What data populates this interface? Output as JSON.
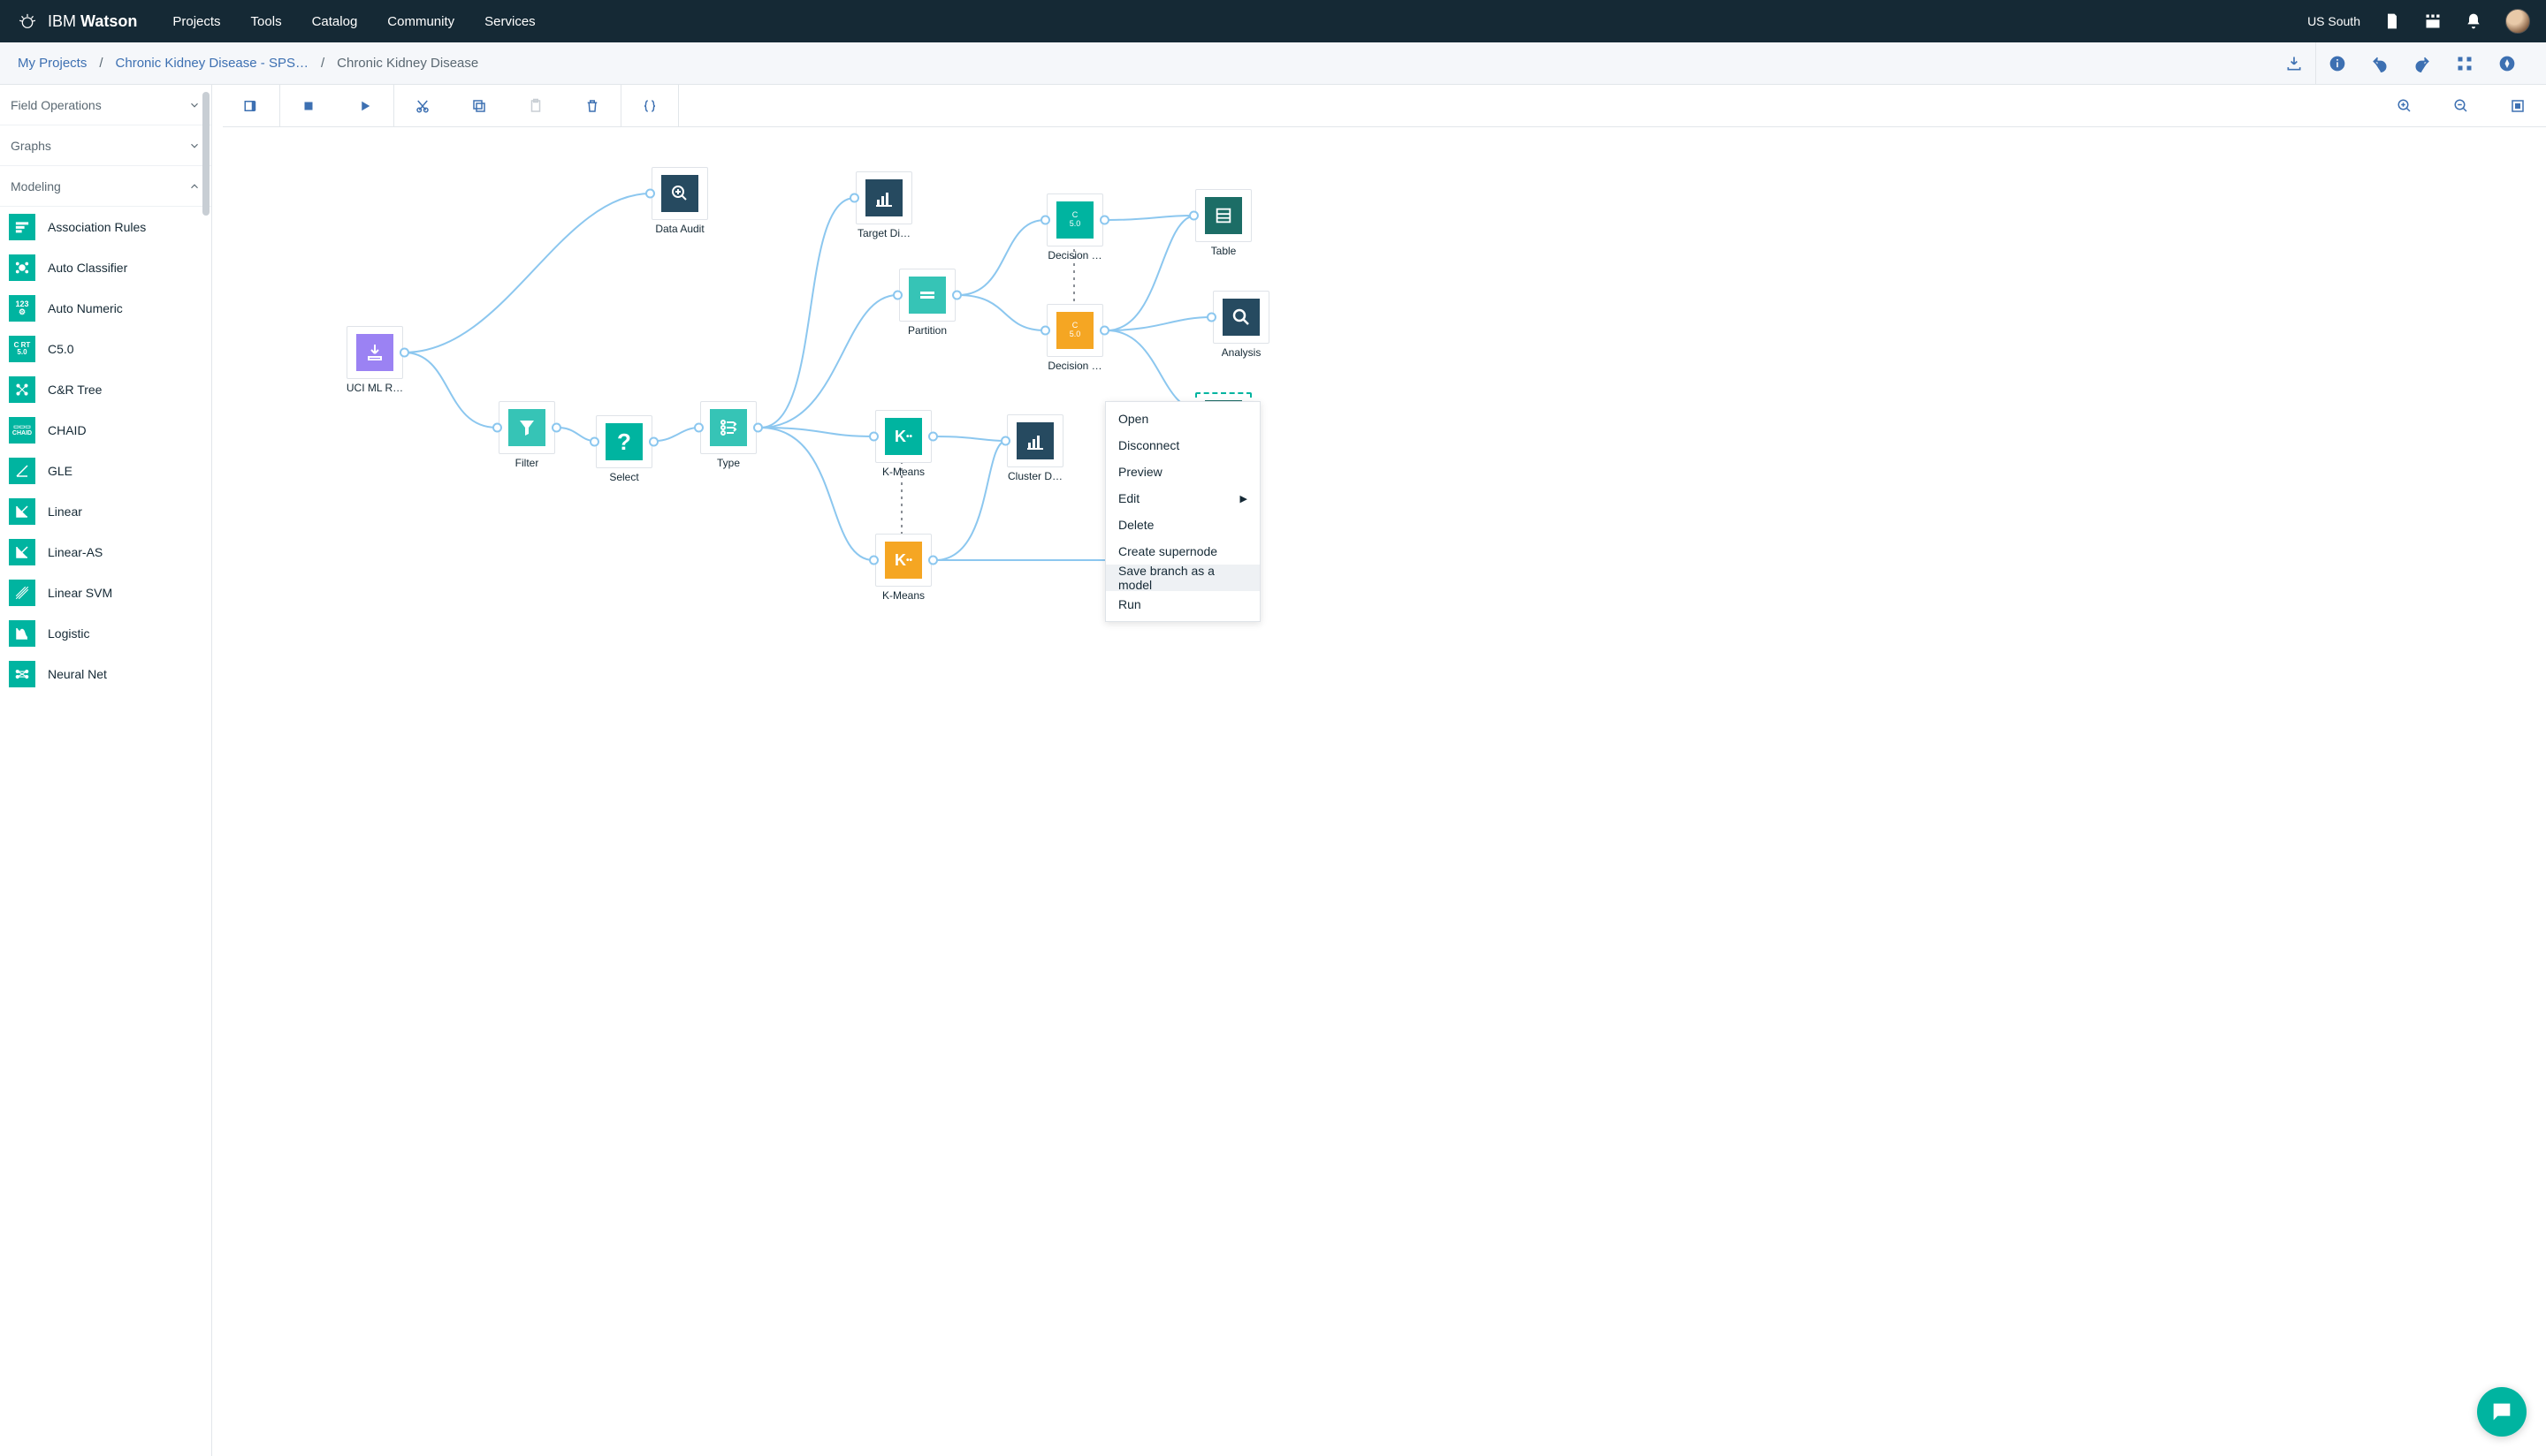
{
  "header": {
    "brand_prefix": "IBM",
    "brand_name": "Watson",
    "nav": [
      "Projects",
      "Tools",
      "Catalog",
      "Community",
      "Services"
    ],
    "region": "US South"
  },
  "breadcrumb": {
    "items": [
      "My Projects",
      "Chronic Kidney Disease - SPS…",
      "Chronic Kidney Disease"
    ]
  },
  "sidebar": {
    "groups": [
      {
        "label": "Field Operations",
        "expanded": false
      },
      {
        "label": "Graphs",
        "expanded": false
      },
      {
        "label": "Modeling",
        "expanded": true
      }
    ],
    "modeling_items": [
      "Association Rules",
      "Auto Classifier",
      "Auto Numeric",
      "C5.0",
      "C&R Tree",
      "CHAID",
      "GLE",
      "Linear",
      "Linear-AS",
      "Linear SVM",
      "Logistic",
      "Neural Net"
    ]
  },
  "canvas": {
    "nodes": {
      "uci": {
        "label": "UCI ML R…"
      },
      "audit": {
        "label": "Data Audit"
      },
      "filter": {
        "label": "Filter"
      },
      "select": {
        "label": "Select"
      },
      "type": {
        "label": "Type"
      },
      "target": {
        "label": "Target Di…"
      },
      "partition": {
        "label": "Partition"
      },
      "kmeans1": {
        "label": "K-Means"
      },
      "kmeans2": {
        "label": "K-Means"
      },
      "cluster": {
        "label": "Cluster D…"
      },
      "dec1": {
        "label": "Decision …"
      },
      "dec2": {
        "label": "Decision …"
      },
      "table": {
        "label": "Table"
      },
      "analysis": {
        "label": "Analysis"
      }
    }
  },
  "context_menu": {
    "items": [
      "Open",
      "Disconnect",
      "Preview",
      "Edit",
      "Delete",
      "Create supernode",
      "Save branch as a model",
      "Run"
    ],
    "submenu_index": 3,
    "hover_index": 6
  },
  "colors": {
    "teal": "#00b4a0",
    "dark_teal": "#1c6d66",
    "dark": "#264a60",
    "purple": "#9b82f3",
    "orange": "#f5a623",
    "link_blue": "#3d70b2",
    "edge": "#8cc7ef"
  }
}
